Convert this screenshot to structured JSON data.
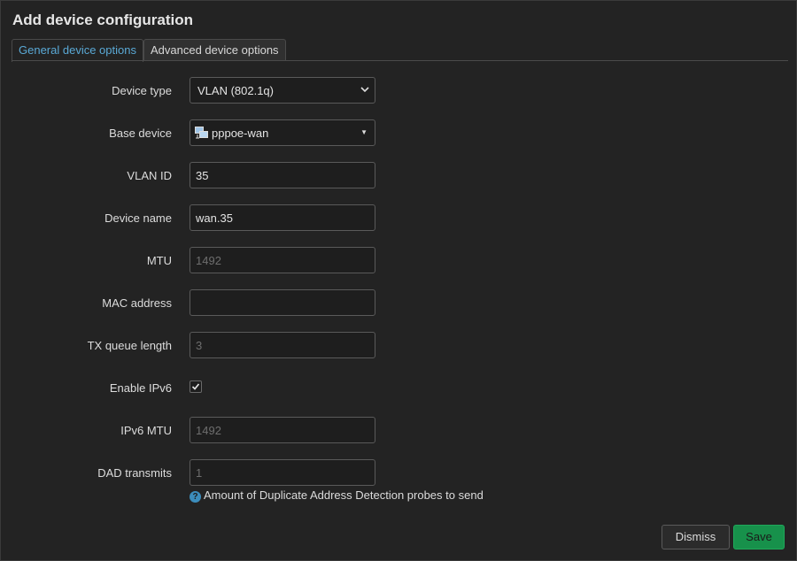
{
  "dialog": {
    "title": "Add device configuration",
    "tabs": [
      {
        "label": "General device options",
        "active": true
      },
      {
        "label": "Advanced device options",
        "active": false
      }
    ]
  },
  "form": {
    "device_type": {
      "label": "Device type",
      "value": "VLAN (802.1q)"
    },
    "base_device": {
      "label": "Base device",
      "value": "pppoe-wan",
      "icon": "network-device-icon"
    },
    "vlan_id": {
      "label": "VLAN ID",
      "value": "35",
      "placeholder": ""
    },
    "device_name": {
      "label": "Device name",
      "value": "wan.35",
      "placeholder": ""
    },
    "mtu": {
      "label": "MTU",
      "value": "",
      "placeholder": "1492"
    },
    "mac_address": {
      "label": "MAC address",
      "value": "",
      "placeholder": ""
    },
    "tx_queue_length": {
      "label": "TX queue length",
      "value": "",
      "placeholder": "3"
    },
    "enable_ipv6": {
      "label": "Enable IPv6",
      "checked": true
    },
    "ipv6_mtu": {
      "label": "IPv6 MTU",
      "value": "",
      "placeholder": "1492"
    },
    "dad_transmits": {
      "label": "DAD transmits",
      "value": "",
      "placeholder": "1",
      "help": "Amount of Duplicate Address Detection probes to send",
      "help_icon": "?"
    }
  },
  "buttons": {
    "dismiss": "Dismiss",
    "save": "Save"
  },
  "colors": {
    "background": "#232323",
    "accent": "#5aa9d6",
    "save": "#17914b",
    "help_icon": "#3c8dbc"
  }
}
